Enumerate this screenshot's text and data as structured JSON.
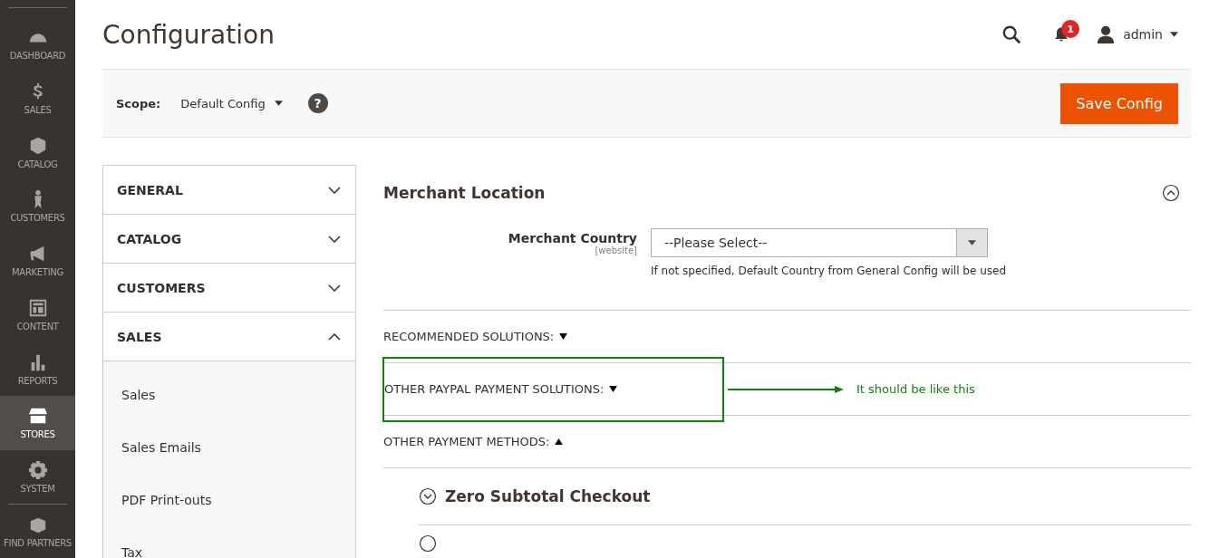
{
  "nav": [
    {
      "label": "DASHBOARD",
      "selected": false
    },
    {
      "label": "SALES",
      "selected": false
    },
    {
      "label": "CATALOG",
      "selected": false
    },
    {
      "label": "CUSTOMERS",
      "selected": false
    },
    {
      "label": "MARKETING",
      "selected": false
    },
    {
      "label": "CONTENT",
      "selected": false
    },
    {
      "label": "REPORTS",
      "selected": false
    },
    {
      "label": "STORES",
      "selected": true
    },
    {
      "label": "SYSTEM",
      "selected": false
    },
    {
      "label": "FIND PARTNERS",
      "selected": false
    }
  ],
  "page_title": "Configuration",
  "header": {
    "notifications": "1",
    "user": "admin"
  },
  "scope": {
    "label": "Scope:",
    "value": "Default Config",
    "help": "?",
    "save_button": "Save Config"
  },
  "config_tabs": [
    {
      "label": "GENERAL",
      "expanded": false
    },
    {
      "label": "CATALOG",
      "expanded": false
    },
    {
      "label": "CUSTOMERS",
      "expanded": false
    },
    {
      "label": "SALES",
      "expanded": true,
      "children": [
        {
          "label": "Sales"
        },
        {
          "label": "Sales Emails"
        },
        {
          "label": "PDF Print-outs"
        },
        {
          "label": "Tax"
        }
      ]
    }
  ],
  "merchant_location": {
    "title": "Merchant Location",
    "expanded": true,
    "field_label": "Merchant Country",
    "scope": "[website]",
    "value": "--Please Select--",
    "note": "If not specified, Default Country from General Config will be used"
  },
  "solution_groups": [
    {
      "label": "RECOMMENDED SOLUTIONS:",
      "expanded": false,
      "highlighted": false
    },
    {
      "label": "OTHER PAYPAL PAYMENT SOLUTIONS:",
      "expanded": false,
      "highlighted": true
    },
    {
      "label": "OTHER PAYMENT METHODS:",
      "expanded": true,
      "highlighted": false
    }
  ],
  "payment_methods": [
    {
      "title": "Zero Subtotal Checkout"
    }
  ],
  "annotation": {
    "text": "It should be like this"
  }
}
